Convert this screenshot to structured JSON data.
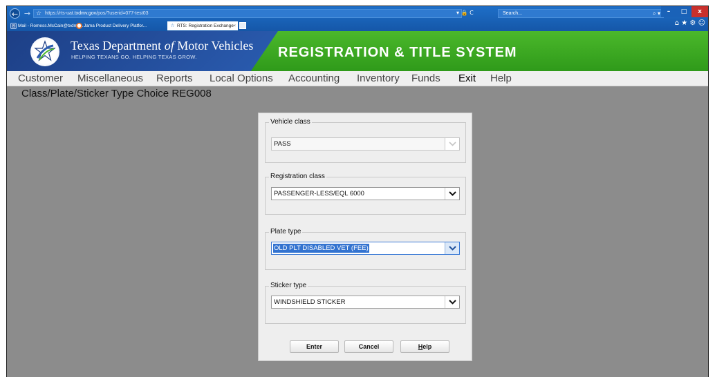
{
  "browser": {
    "url_prefix": "https://rts-uat.",
    "url_domain": "txdmv.gov",
    "url_path": "/pos/?userid=077-test03",
    "address_icons": "▾ 🔒 C",
    "search_placeholder": "Search...",
    "search_icon_glyph": "⌕ ▾",
    "tabs": [
      {
        "label": "Mail - Romess.McCain@txdmv...",
        "icon": "✉",
        "active": false
      },
      {
        "label": "Jama Product Delivery Platfor...",
        "icon": "●",
        "active": false
      },
      {
        "label": "RTS: Registration Exchange",
        "icon": "☆",
        "active": true,
        "close": "×"
      }
    ],
    "window_controls": {
      "minimize": "–",
      "maximize": "□",
      "close": "x"
    },
    "toolbar_icons": "⌂ ★ ⚙ ☺"
  },
  "header": {
    "org_name_part1": "Texas Department ",
    "org_name_of": "of",
    "org_name_part2": " Motor Vehicles",
    "tagline": "HELPING TEXANS GO. HELPING TEXAS GROW.",
    "system_title": "REGISTRATION & TITLE SYSTEM"
  },
  "menu": [
    "Customer",
    "Miscellaneous",
    "Reports",
    "Local Options",
    "Accounting",
    "Inventory",
    "Funds",
    "Exit",
    "Help"
  ],
  "page_title": "Class/Plate/Sticker Type Choice REG008",
  "dialog": {
    "vehicle_class": {
      "label": "Vehicle class",
      "value": "PASS"
    },
    "registration_class": {
      "label": "Registration class",
      "value": "PASSENGER-LESS/EQL 6000"
    },
    "plate_type": {
      "label": "Plate type",
      "value": "OLD PLT DISABLED VET (FEE)"
    },
    "sticker_type": {
      "label": "Sticker type",
      "value": "WINDSHIELD STICKER"
    },
    "buttons": {
      "enter": "Enter",
      "cancel": "Cancel",
      "help_mnemonic": "H",
      "help_rest": "elp"
    }
  }
}
